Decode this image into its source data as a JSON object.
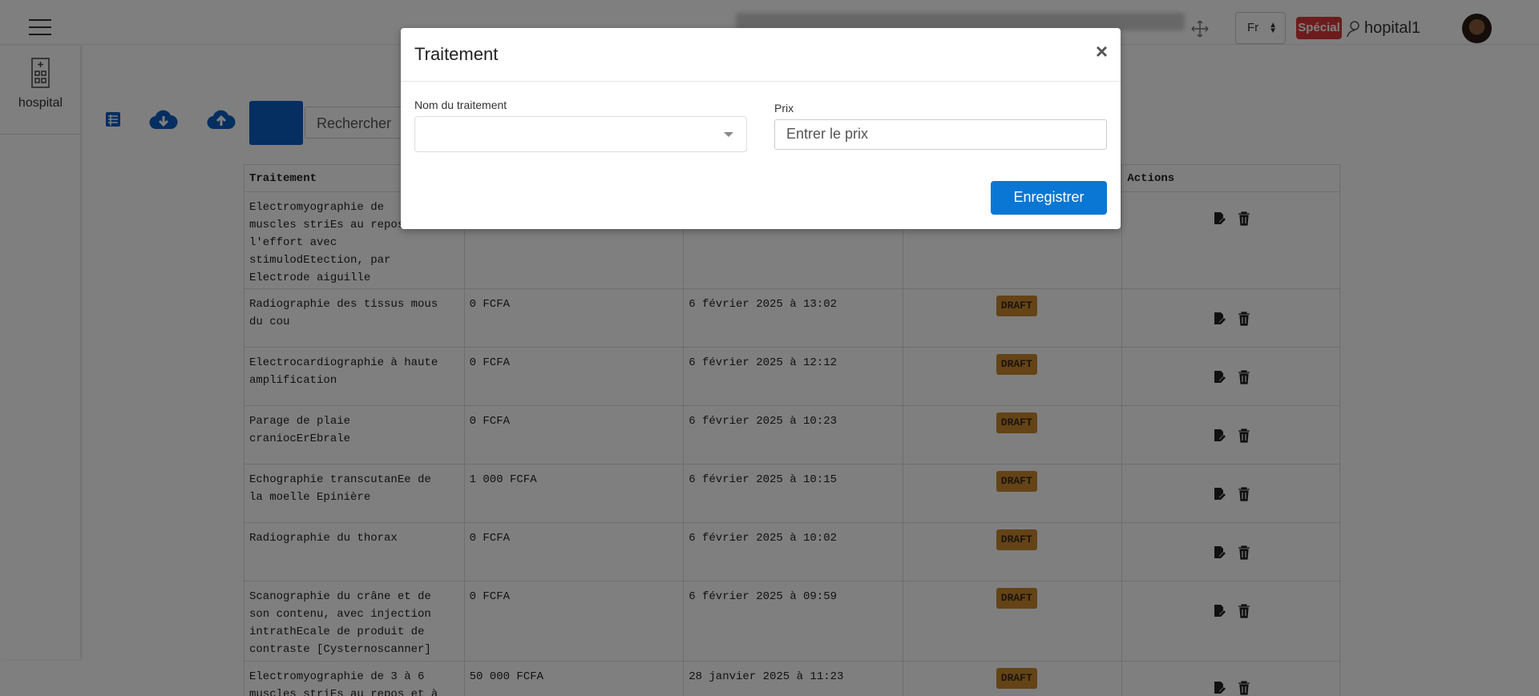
{
  "topbar": {
    "language": "Fr",
    "special_badge": "Spécial",
    "username": "hopital1"
  },
  "sidebar": {
    "items": [
      {
        "label": "hospital",
        "icon": "hospital-building-icon"
      }
    ]
  },
  "toolbar": {
    "search_placeholder": "Rechercher",
    "icons": [
      "list-icon",
      "cloud-download-icon",
      "cloud-upload-icon"
    ]
  },
  "table": {
    "headers": [
      "Traitement",
      "",
      "",
      "",
      "Actions"
    ],
    "rows": [
      {
        "name": "Electromyographie de\nmuscles striEs au repos et à\nl'effort avec\nstimulodEtection, par\nElectrode aiguille",
        "price": "",
        "date": "",
        "status": ""
      },
      {
        "name": "Radiographie des tissus mous\ndu cou",
        "price": "0 FCFA",
        "date": "6 février 2025 à 13:02",
        "status": "DRAFT"
      },
      {
        "name": "Electrocardiographie à haute\namplification",
        "price": "0 FCFA",
        "date": "6 février 2025 à 12:12",
        "status": "DRAFT"
      },
      {
        "name": "Parage de plaie\ncraniocErEbrale",
        "price": "0 FCFA",
        "date": "6 février 2025 à 10:23",
        "status": "DRAFT"
      },
      {
        "name": "Echographie transcutanEe de\nla moelle Epinière",
        "price": "1 000 FCFA",
        "date": "6 février 2025 à 10:15",
        "status": "DRAFT"
      },
      {
        "name": "Radiographie du thorax",
        "price": "0 FCFA",
        "date": "6 février 2025 à 10:02",
        "status": "DRAFT"
      },
      {
        "name": "Scanographie du crâne et de\nson contenu, avec injection\nintrathEcale de produit de\ncontraste [Cysternoscanner]",
        "price": "0 FCFA",
        "date": "6 février 2025 à 09:59",
        "status": "DRAFT"
      },
      {
        "name": "Electromyographie de 3 à 6\nmuscles striEs au repos et à",
        "price": "50 000 FCFA",
        "date": "28 janvier 2025 à 11:23",
        "status": "DRAFT"
      }
    ]
  },
  "modal": {
    "title": "Traitement",
    "close_label": "×",
    "name_label": "Nom du traitement",
    "name_value": "",
    "price_label": "Prix",
    "price_placeholder": "Entrer le prix",
    "save_label": "Enregistrer"
  },
  "colors": {
    "primary": "#0a77d5",
    "toolbar_blue": "#0a5cc2",
    "draft_badge": "#c8862f",
    "special_badge": "#d9383a"
  }
}
